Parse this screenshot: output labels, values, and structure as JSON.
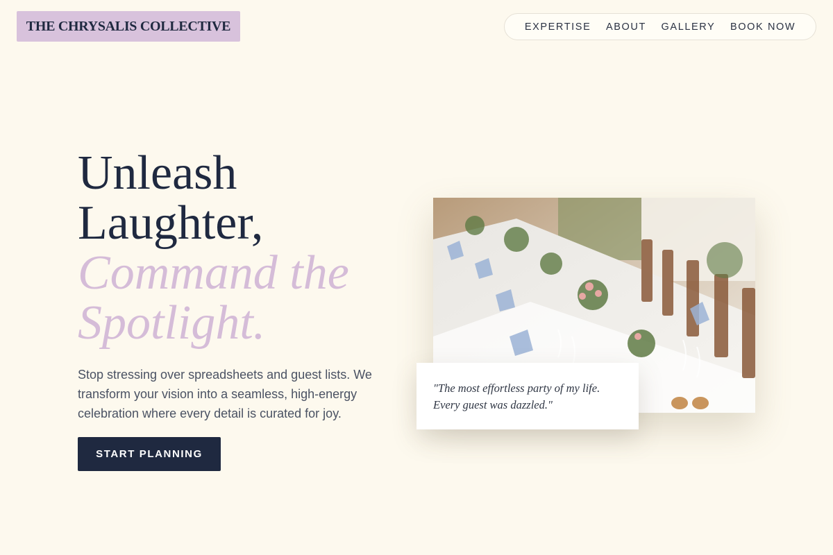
{
  "brand": {
    "name": "THE CHRYSALIS COLLECTIVE"
  },
  "nav": {
    "items": [
      "EXPERTISE",
      "ABOUT",
      "GALLERY",
      "BOOK NOW"
    ]
  },
  "hero": {
    "headline_line1": "Unleash",
    "headline_line2": "Laughter,",
    "headline_accent_line1": "Command the",
    "headline_accent_line2": "Spotlight.",
    "lede": "Stop stressing over spreadsheets and guest lists. We transform your vision into a seamless, high-energy celebration where every detail is curated for joy.",
    "cta_label": "START PLANNING"
  },
  "testimonial": {
    "line1": "\"The most effortless party of my life.",
    "line2": "Every guest was dazzled.\""
  },
  "colors": {
    "background": "#fdf9ee",
    "ink": "#1f2940",
    "accent": "#d5bcd8"
  }
}
